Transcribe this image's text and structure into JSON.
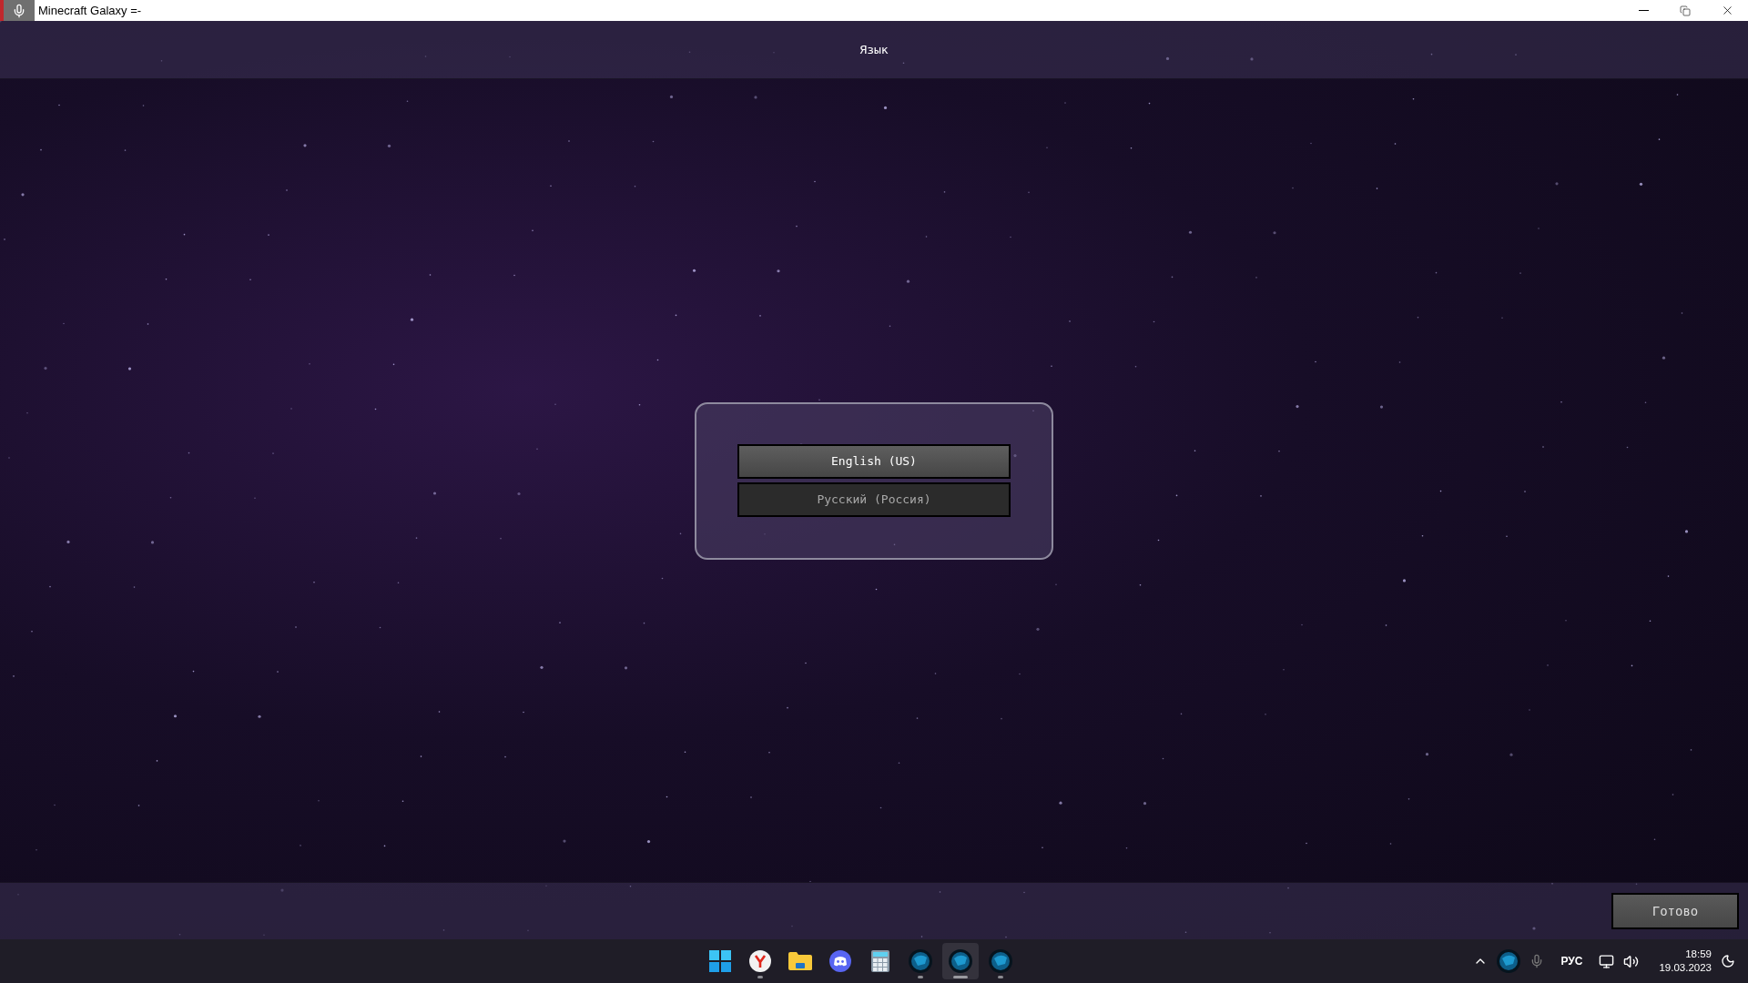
{
  "window": {
    "title": "Minecraft Galaxy =-"
  },
  "header": {
    "title": "Язык"
  },
  "languages": [
    {
      "label": "English (US)",
      "selected": true
    },
    {
      "label": "Русский (Россия)",
      "selected": false
    }
  ],
  "done_button": "Готово",
  "taskbar": {
    "apps": [
      {
        "kind": "start",
        "running": false,
        "selected": false
      },
      {
        "kind": "browser",
        "running": true,
        "selected": false
      },
      {
        "kind": "folder",
        "running": false,
        "selected": false
      },
      {
        "kind": "chat",
        "running": false,
        "selected": false
      },
      {
        "kind": "calculator",
        "running": false,
        "selected": false
      },
      {
        "kind": "game",
        "running": true,
        "selected": false
      },
      {
        "kind": "game",
        "running": true,
        "selected": true
      },
      {
        "kind": "game",
        "running": true,
        "selected": false
      }
    ],
    "tray": {
      "language": "РУС",
      "time": "18:59",
      "date": "19.03.2023"
    }
  }
}
